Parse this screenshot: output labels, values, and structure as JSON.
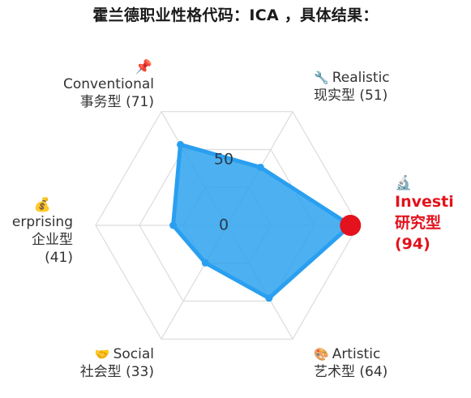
{
  "title": "霍兰德职业性格代码：ICA ，具体结果：",
  "chart_data": {
    "type": "radar",
    "max": 100,
    "ticks": [
      0,
      50
    ],
    "tick_labels": [
      "0",
      "50"
    ],
    "fill_color": "#2ea3ef",
    "stroke_color": "#2a9ff0",
    "highlight_color": "#e3121c",
    "axes": [
      {
        "key": "I",
        "en": "Investi",
        "zh": "研究型",
        "value": 94,
        "value_label": "(94)",
        "icon": "microscope-icon",
        "glyph": "🔬",
        "highlight": true
      },
      {
        "key": "R",
        "en": "Realistic",
        "zh": "现实型",
        "value": 51,
        "value_label": "(51)",
        "icon": "wrench-icon",
        "glyph": "🔧",
        "highlight": false
      },
      {
        "key": "C",
        "en": "Conventional",
        "zh": "事务型",
        "value": 71,
        "value_label": "(71)",
        "icon": "pushpin-icon",
        "glyph": "📌",
        "highlight": false
      },
      {
        "key": "E",
        "en": "erprising",
        "zh": "企业型",
        "value": 41,
        "value_label": "(41)",
        "icon": "money-bag-icon",
        "glyph": "💰",
        "highlight": false
      },
      {
        "key": "S",
        "en": "Social",
        "zh": "社会型",
        "value": 33,
        "value_label": "(33)",
        "icon": "handshake-icon",
        "glyph": "🤝",
        "highlight": false
      },
      {
        "key": "A",
        "en": "Artistic",
        "zh": "艺术型",
        "value": 64,
        "value_label": "(64)",
        "icon": "palette-icon",
        "glyph": "🎨",
        "highlight": false
      }
    ]
  }
}
